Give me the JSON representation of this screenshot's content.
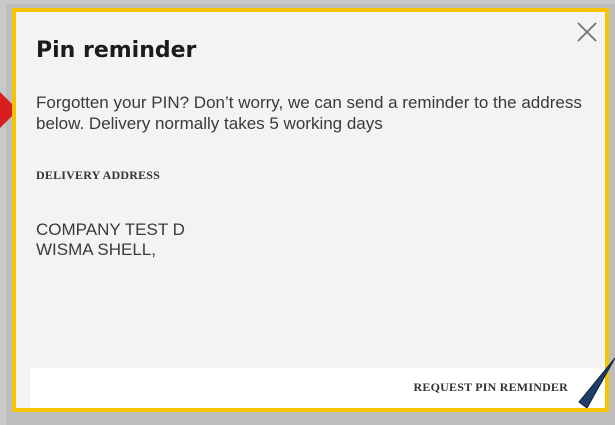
{
  "dialog": {
    "title": "Pin reminder",
    "description": "Forgotten your PIN? Don’t worry, we can send a reminder to the address below. Delivery normally takes 5 working days",
    "address_label": "DELIVERY ADDRESS",
    "address_lines": [
      "COMPANY TEST D",
      "WISMA SHELL,"
    ],
    "request_button_label": "REQUEST PIN REMINDER",
    "close_icon": "close-icon"
  },
  "colors": {
    "border": "#f4c400",
    "dialog_bg": "#f3f3f3",
    "footer_bg": "#ffffff",
    "left_marker": "#d81e1e",
    "right_marker": "#1f3f6a"
  }
}
